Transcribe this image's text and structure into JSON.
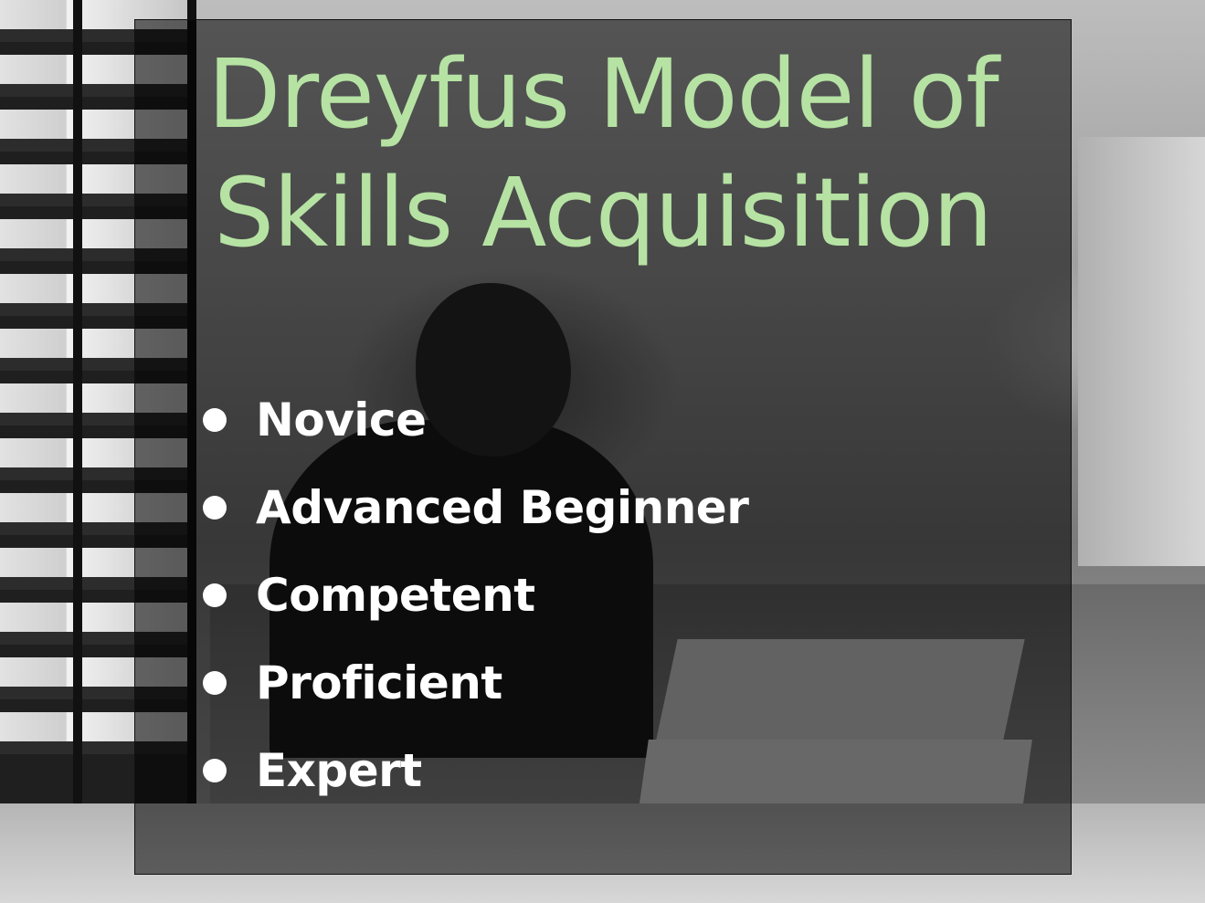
{
  "slide": {
    "title_line1": "Dreyfus Model of",
    "title_line2": "Skills Acquisition",
    "items": [
      "Novice",
      "Advanced Beginner",
      "Competent",
      "Proficient",
      "Expert"
    ]
  },
  "colors": {
    "title": "#b6e3a3",
    "items": "#ffffff",
    "overlay": "rgba(0,0,0,0.55)"
  }
}
